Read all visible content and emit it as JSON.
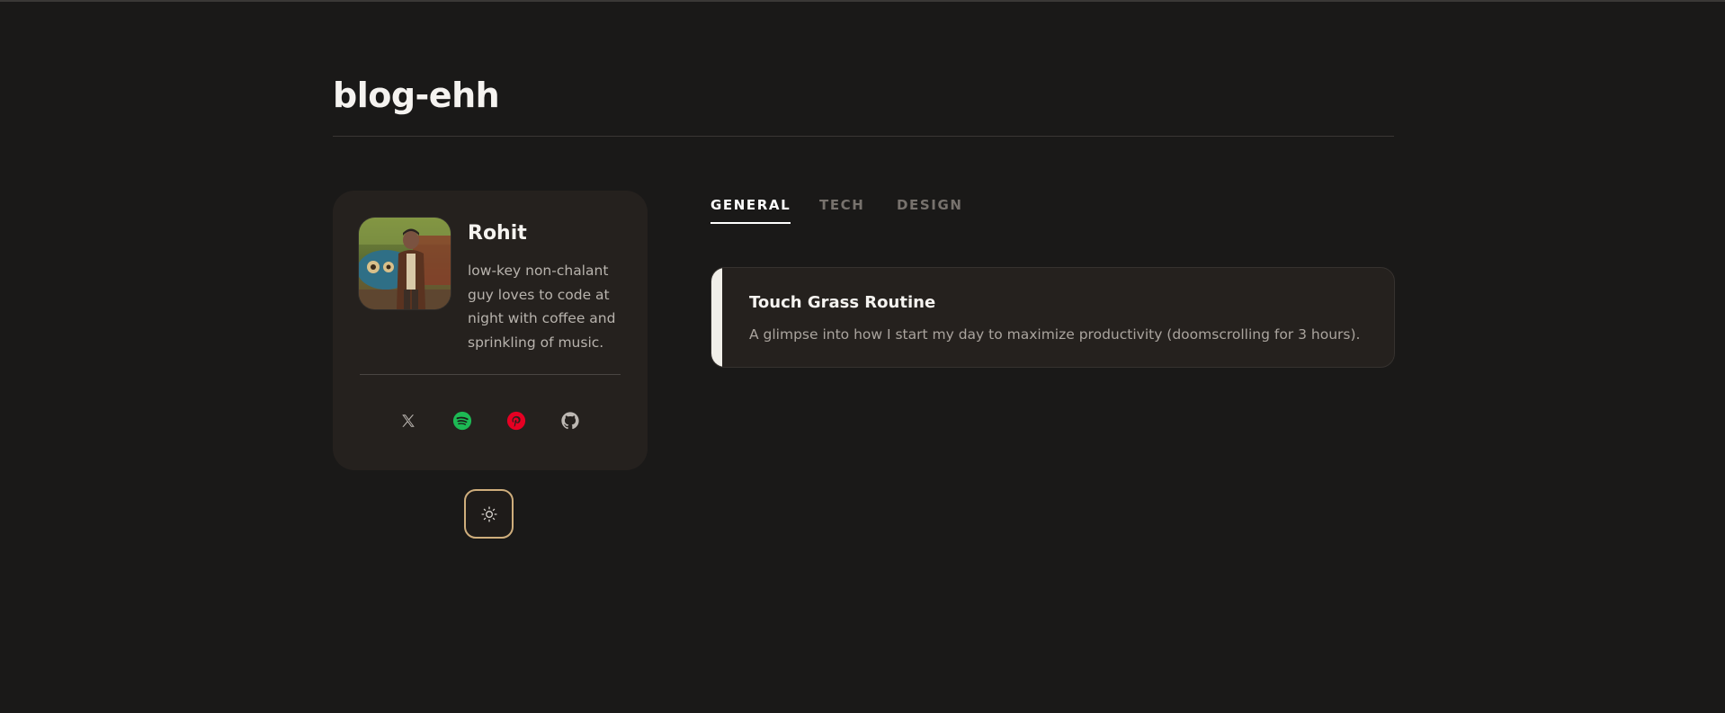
{
  "site": {
    "title": "blog-ehh"
  },
  "profile": {
    "name": "Rohit",
    "bio": "low-key non-chalant guy loves to code at night with coffee and sprinkling of music.",
    "avatar_icon": "person-photo-avatar"
  },
  "socials": [
    {
      "name": "x-icon",
      "color": "#bdb8b3"
    },
    {
      "name": "spotify-icon",
      "color": "#1db954"
    },
    {
      "name": "pinterest-icon",
      "color": "#e60023"
    },
    {
      "name": "github-icon",
      "color": "#bdb8b3"
    }
  ],
  "theme_toggle": {
    "icon": "sun-icon",
    "border_color": "#cfae7c"
  },
  "tabs": [
    {
      "label": "GENERAL",
      "active": true
    },
    {
      "label": "TECH",
      "active": false
    },
    {
      "label": "DESIGN",
      "active": false
    }
  ],
  "posts": [
    {
      "title": "Touch Grass Routine",
      "description": "A glimpse into how I start my day to maximize productivity (doomscrolling for 3 hours)."
    }
  ],
  "colors": {
    "background": "#1a1918",
    "card": "#25211e",
    "accent_border": "#cfae7c"
  }
}
